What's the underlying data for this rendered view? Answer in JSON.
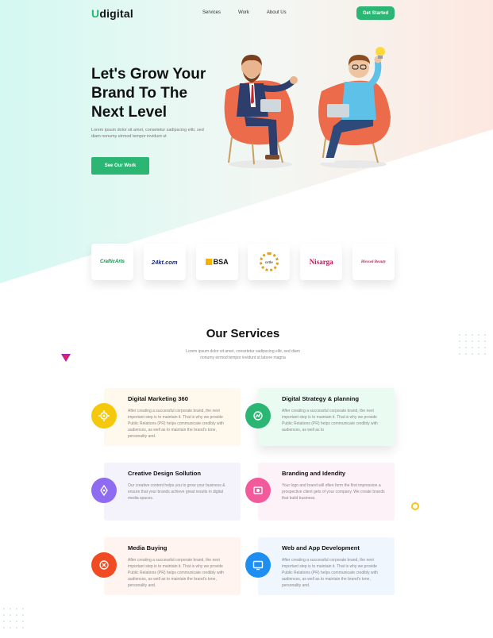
{
  "colors": {
    "accent_green": "#2bb673",
    "hero_mint": "#d7f8f1",
    "hero_peach": "#fde9e2"
  },
  "brand": {
    "prefix": "U",
    "rest": "digital"
  },
  "nav": {
    "items": [
      "Services",
      "Work",
      "About Us"
    ],
    "cta": "Get Started"
  },
  "hero": {
    "title_lines": [
      "Let's Grow Your",
      "Brand To The",
      "Next Level"
    ],
    "subtitle": "Lorem ipsum dolor sit amet, consetetur sadipscing elitr, sed diam nonumy eirmod tempor invidunt ut",
    "cta": "See Our Work"
  },
  "partners": [
    {
      "name": "CrafticArts",
      "color": "#1a8a4a"
    },
    {
      "name": "24kt.com",
      "color": "#1b2a7a"
    },
    {
      "name": "BSA",
      "color": "#111111"
    },
    {
      "name": "ortle",
      "color": "#555555"
    },
    {
      "name": "Nisarga",
      "color": "#c2185b"
    },
    {
      "name": "Blessed Beauty",
      "color": "#b03060"
    }
  ],
  "services_section": {
    "title": "Our Services",
    "subtitle": "Lorem ipsum dolor sit amet, consetetur sadipscing elitr, sed diam nonumy eirmod tempor invidunt ut labore magna"
  },
  "services": [
    {
      "title": "Digital Marketing 360",
      "desc": "After creating a successful corporate brand, the next important step is to maintain it. That is why we provide Public Relations (PR) helps communicate credibly with audiences, as well as to maintain the brand's tone, personality and.",
      "icon": "gear-megaphone-icon",
      "color": "#f6c80b",
      "bg": "#fff8ec"
    },
    {
      "title": "Digital Strategy & planning",
      "desc": "After creating a successful corporate brand, the next important step is to maintain it. That is why we provide Public Relations (PR) helps communicate credibly with audiences, as well as to",
      "icon": "chart-strategy-icon",
      "color": "#2bb673",
      "bg": "#eafbf2"
    },
    {
      "title": "Creative Design Sollution",
      "desc": "Our creative content helps you to grow your business & ensure that your brands achieve great results in digital media spaces.",
      "icon": "pen-nib-icon",
      "color": "#8e6bf0",
      "bg": "#f4f3fb"
    },
    {
      "title": "Branding and Idendity",
      "desc": "Your logo and brand will often form the first impression a prospective client gets of your company. We create brands that build business.",
      "icon": "brand-identity-icon",
      "color": "#f25a9b",
      "bg": "#fdf2f7"
    },
    {
      "title": "Media Buying",
      "desc": "After creating a successful corporate brand, the next important step is to maintain it. That is why we provide Public Relations (PR) helps communicate credibly with audiences, as well as to maintain the brand's tone, personality and.",
      "icon": "media-buying-icon",
      "color": "#f04b23",
      "bg": "#fff4ef"
    },
    {
      "title": "Web and App Development",
      "desc": "After creating a successful corporate brand, the next important step is to maintain it. That is why we provide Public Relations (PR) helps communicate credibly with audiences, as well as to maintain the brand's tone, personality and.",
      "icon": "web-app-icon",
      "color": "#1f8ef1",
      "bg": "#eff6fd"
    }
  ]
}
